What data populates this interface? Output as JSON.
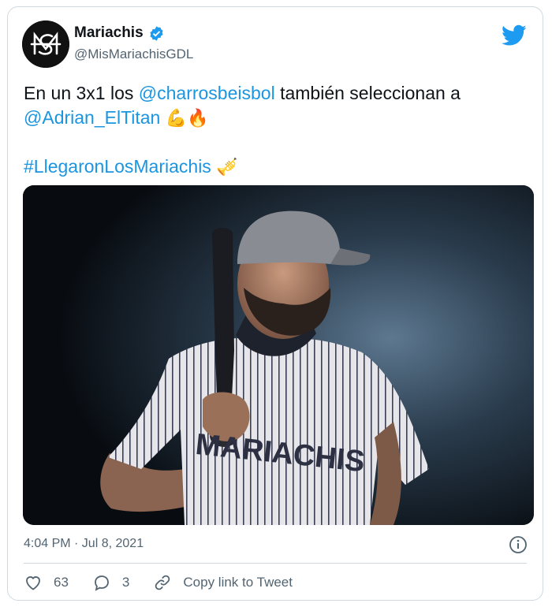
{
  "account": {
    "name": "Mariachis",
    "handle": "@MisMariachisGDL",
    "avatar_icon": "mariachis-monogram-logo",
    "verified_icon": "verified-badge-icon"
  },
  "tweet": {
    "line1_prefix": "En un 3x1 los ",
    "mention1": "@charrosbeisbol",
    "line1_suffix": " también seleccionan a",
    "mention2": "@Adrian_ElTitan",
    "emojis": "💪🔥",
    "hashtag": "#LlegaronLosMariachis",
    "hashtag_emoji": "🎺"
  },
  "media": {
    "jersey_text": "MARIACHIS"
  },
  "meta": {
    "timestamp": "4:04 PM · Jul 8, 2021"
  },
  "actions": {
    "likes": "63",
    "replies": "3",
    "copy_link": "Copy link to Tweet"
  },
  "colors": {
    "link": "#1b95e0",
    "twitter_blue": "#1d9bf0",
    "muted": "#536471"
  }
}
